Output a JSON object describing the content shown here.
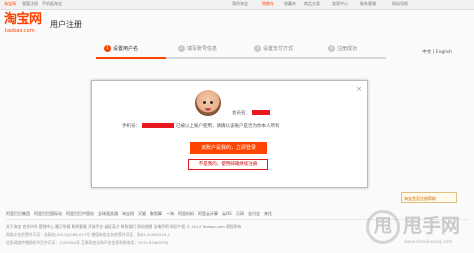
{
  "topbar": {
    "left_links": [
      "淘宝网",
      "我要注册",
      "手机逛淘宝"
    ],
    "right_links": [
      "我的淘宝",
      "购物车",
      "收藏夹",
      "商品分类",
      "卖家中心",
      "联系客服",
      "网站导航"
    ]
  },
  "header": {
    "logo_cn": "淘宝网",
    "logo_en": "taobao.com",
    "title": "用户注册"
  },
  "language": {
    "selected": "中文 | English"
  },
  "steps": [
    {
      "num": "1",
      "label": "设置用户名",
      "active": true
    },
    {
      "num": "2",
      "label": "填写账号信息",
      "active": false
    },
    {
      "num": "3",
      "label": "设置支付方式",
      "active": false
    },
    {
      "num": "4",
      "label": "注册成功",
      "active": false
    }
  ],
  "modal": {
    "close_label": "×",
    "member_label": "会员名：",
    "phone_label": "手机号：",
    "message": "已被以上账户使用，请确认该账户是否为你本人所有",
    "login_button": "该账户是我的，立即登录",
    "not_me_button": "不是我的，使用邮箱继续注册"
  },
  "float_help": {
    "label": "淘宝会员注册帮助"
  },
  "footer": {
    "tabs": [
      "阿里巴巴集团",
      "阿里巴巴国际站",
      "阿里巴巴中国站",
      "全球速卖通",
      "淘宝网",
      "天猫",
      "聚划算",
      "一淘",
      "阿里妈妈",
      "阿里云计算",
      "云OS",
      "万网",
      "支付宝",
      "来往"
    ],
    "links": "关于淘宝  合作伙伴  营销中心  廉正举报  联系客服  开放平台  诚征英才  联系我们  网站地图  法律声明  知识产权  © 2014 Taobao.com 版权所有",
    "copy1": "网络文化经营许可证：浙网文[2013]0268-027号  增值电信业务经营许可证：浙B2-20080224-1",
    "copy2": "信息网络传播视听节目许可证：1109364号  互联网违法和不良信息举报电话：0571-81683755"
  },
  "watermark": {
    "glyph": "甩",
    "text": "甩手网",
    "url": "www.shoujiwang.com"
  },
  "colors": {
    "brand": "#ff4400",
    "redaction": "#e8191f"
  }
}
